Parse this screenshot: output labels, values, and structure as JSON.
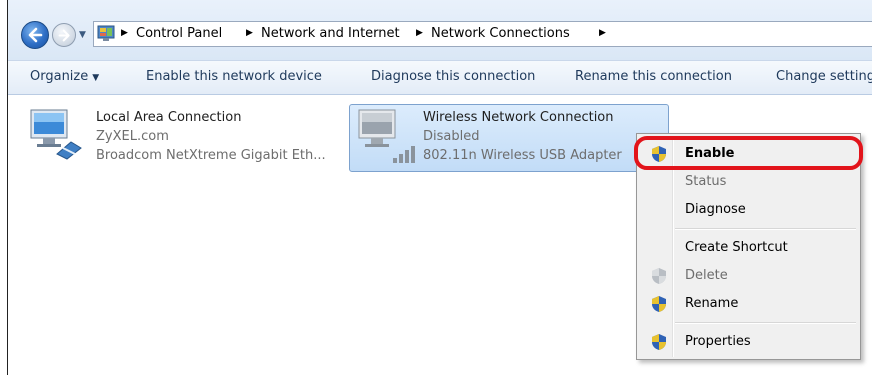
{
  "breadcrumb": {
    "items": [
      "Control Panel",
      "Network and Internet",
      "Network Connections"
    ]
  },
  "toolbar": {
    "organize": "Organize",
    "enable_device": "Enable this network device",
    "diagnose": "Diagnose this connection",
    "rename": "Rename this connection",
    "change_settings": "Change settings"
  },
  "connections": [
    {
      "name": "Local Area Connection",
      "status": "ZyXEL.com",
      "adapter": "Broadcom NetXtreme Gigabit Eth..."
    },
    {
      "name": "Wireless Network Connection",
      "status": "Disabled",
      "adapter": "802.11n Wireless USB Adapter"
    }
  ],
  "context_menu": {
    "enable": "Enable",
    "status": "Status",
    "diagnose": "Diagnose",
    "create_shortcut": "Create Shortcut",
    "delete": "Delete",
    "rename": "Rename",
    "properties": "Properties"
  },
  "colors": {
    "highlight": "#e2141b",
    "accent": "#1e395b",
    "selection": "#c2dcf7"
  }
}
